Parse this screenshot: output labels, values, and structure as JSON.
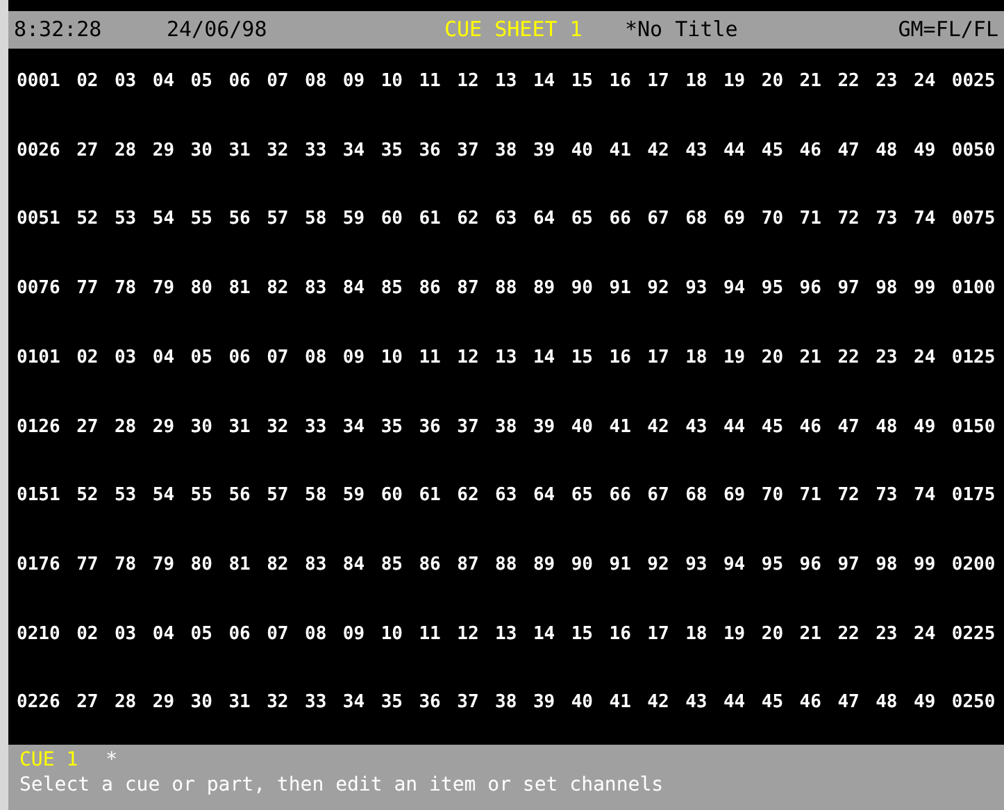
{
  "header": {
    "time": "8:32:28",
    "date": "24/06/98",
    "sheet": "CUE SHEET 1",
    "title": "*No Title",
    "grand_master": "GM=FL/FL"
  },
  "channel_rows": [
    [
      "0001",
      "02",
      "03",
      "04",
      "05",
      "06",
      "07",
      "08",
      "09",
      "10",
      "11",
      "12",
      "13",
      "14",
      "15",
      "16",
      "17",
      "18",
      "19",
      "20",
      "21",
      "22",
      "23",
      "24",
      "0025"
    ],
    [
      "0026",
      "27",
      "28",
      "29",
      "30",
      "31",
      "32",
      "33",
      "34",
      "35",
      "36",
      "37",
      "38",
      "39",
      "40",
      "41",
      "42",
      "43",
      "44",
      "45",
      "46",
      "47",
      "48",
      "49",
      "0050"
    ],
    [
      "0051",
      "52",
      "53",
      "54",
      "55",
      "56",
      "57",
      "58",
      "59",
      "60",
      "61",
      "62",
      "63",
      "64",
      "65",
      "66",
      "67",
      "68",
      "69",
      "70",
      "71",
      "72",
      "73",
      "74",
      "0075"
    ],
    [
      "0076",
      "77",
      "78",
      "79",
      "80",
      "81",
      "82",
      "83",
      "84",
      "85",
      "86",
      "87",
      "88",
      "89",
      "90",
      "91",
      "92",
      "93",
      "94",
      "95",
      "96",
      "97",
      "98",
      "99",
      "0100"
    ],
    [
      "0101",
      "02",
      "03",
      "04",
      "05",
      "06",
      "07",
      "08",
      "09",
      "10",
      "11",
      "12",
      "13",
      "14",
      "15",
      "16",
      "17",
      "18",
      "19",
      "20",
      "21",
      "22",
      "23",
      "24",
      "0125"
    ],
    [
      "0126",
      "27",
      "28",
      "29",
      "30",
      "31",
      "32",
      "33",
      "34",
      "35",
      "36",
      "37",
      "38",
      "39",
      "40",
      "41",
      "42",
      "43",
      "44",
      "45",
      "46",
      "47",
      "48",
      "49",
      "0150"
    ],
    [
      "0151",
      "52",
      "53",
      "54",
      "55",
      "56",
      "57",
      "58",
      "59",
      "60",
      "61",
      "62",
      "63",
      "64",
      "65",
      "66",
      "67",
      "68",
      "69",
      "70",
      "71",
      "72",
      "73",
      "74",
      "0175"
    ],
    [
      "0176",
      "77",
      "78",
      "79",
      "80",
      "81",
      "82",
      "83",
      "84",
      "85",
      "86",
      "87",
      "88",
      "89",
      "90",
      "91",
      "92",
      "93",
      "94",
      "95",
      "96",
      "97",
      "98",
      "99",
      "0200"
    ],
    [
      "0210",
      "02",
      "03",
      "04",
      "05",
      "06",
      "07",
      "08",
      "09",
      "10",
      "11",
      "12",
      "13",
      "14",
      "15",
      "16",
      "17",
      "18",
      "19",
      "20",
      "21",
      "22",
      "23",
      "24",
      "0225"
    ],
    [
      "0226",
      "27",
      "28",
      "29",
      "30",
      "31",
      "32",
      "33",
      "34",
      "35",
      "36",
      "37",
      "38",
      "39",
      "40",
      "41",
      "42",
      "43",
      "44",
      "45",
      "46",
      "47",
      "48",
      "49",
      "0250"
    ]
  ],
  "status_bar": {
    "cue": "CUE 1",
    "marker": "*",
    "prompt": "Select a cue or part, then edit an item or set channels"
  }
}
